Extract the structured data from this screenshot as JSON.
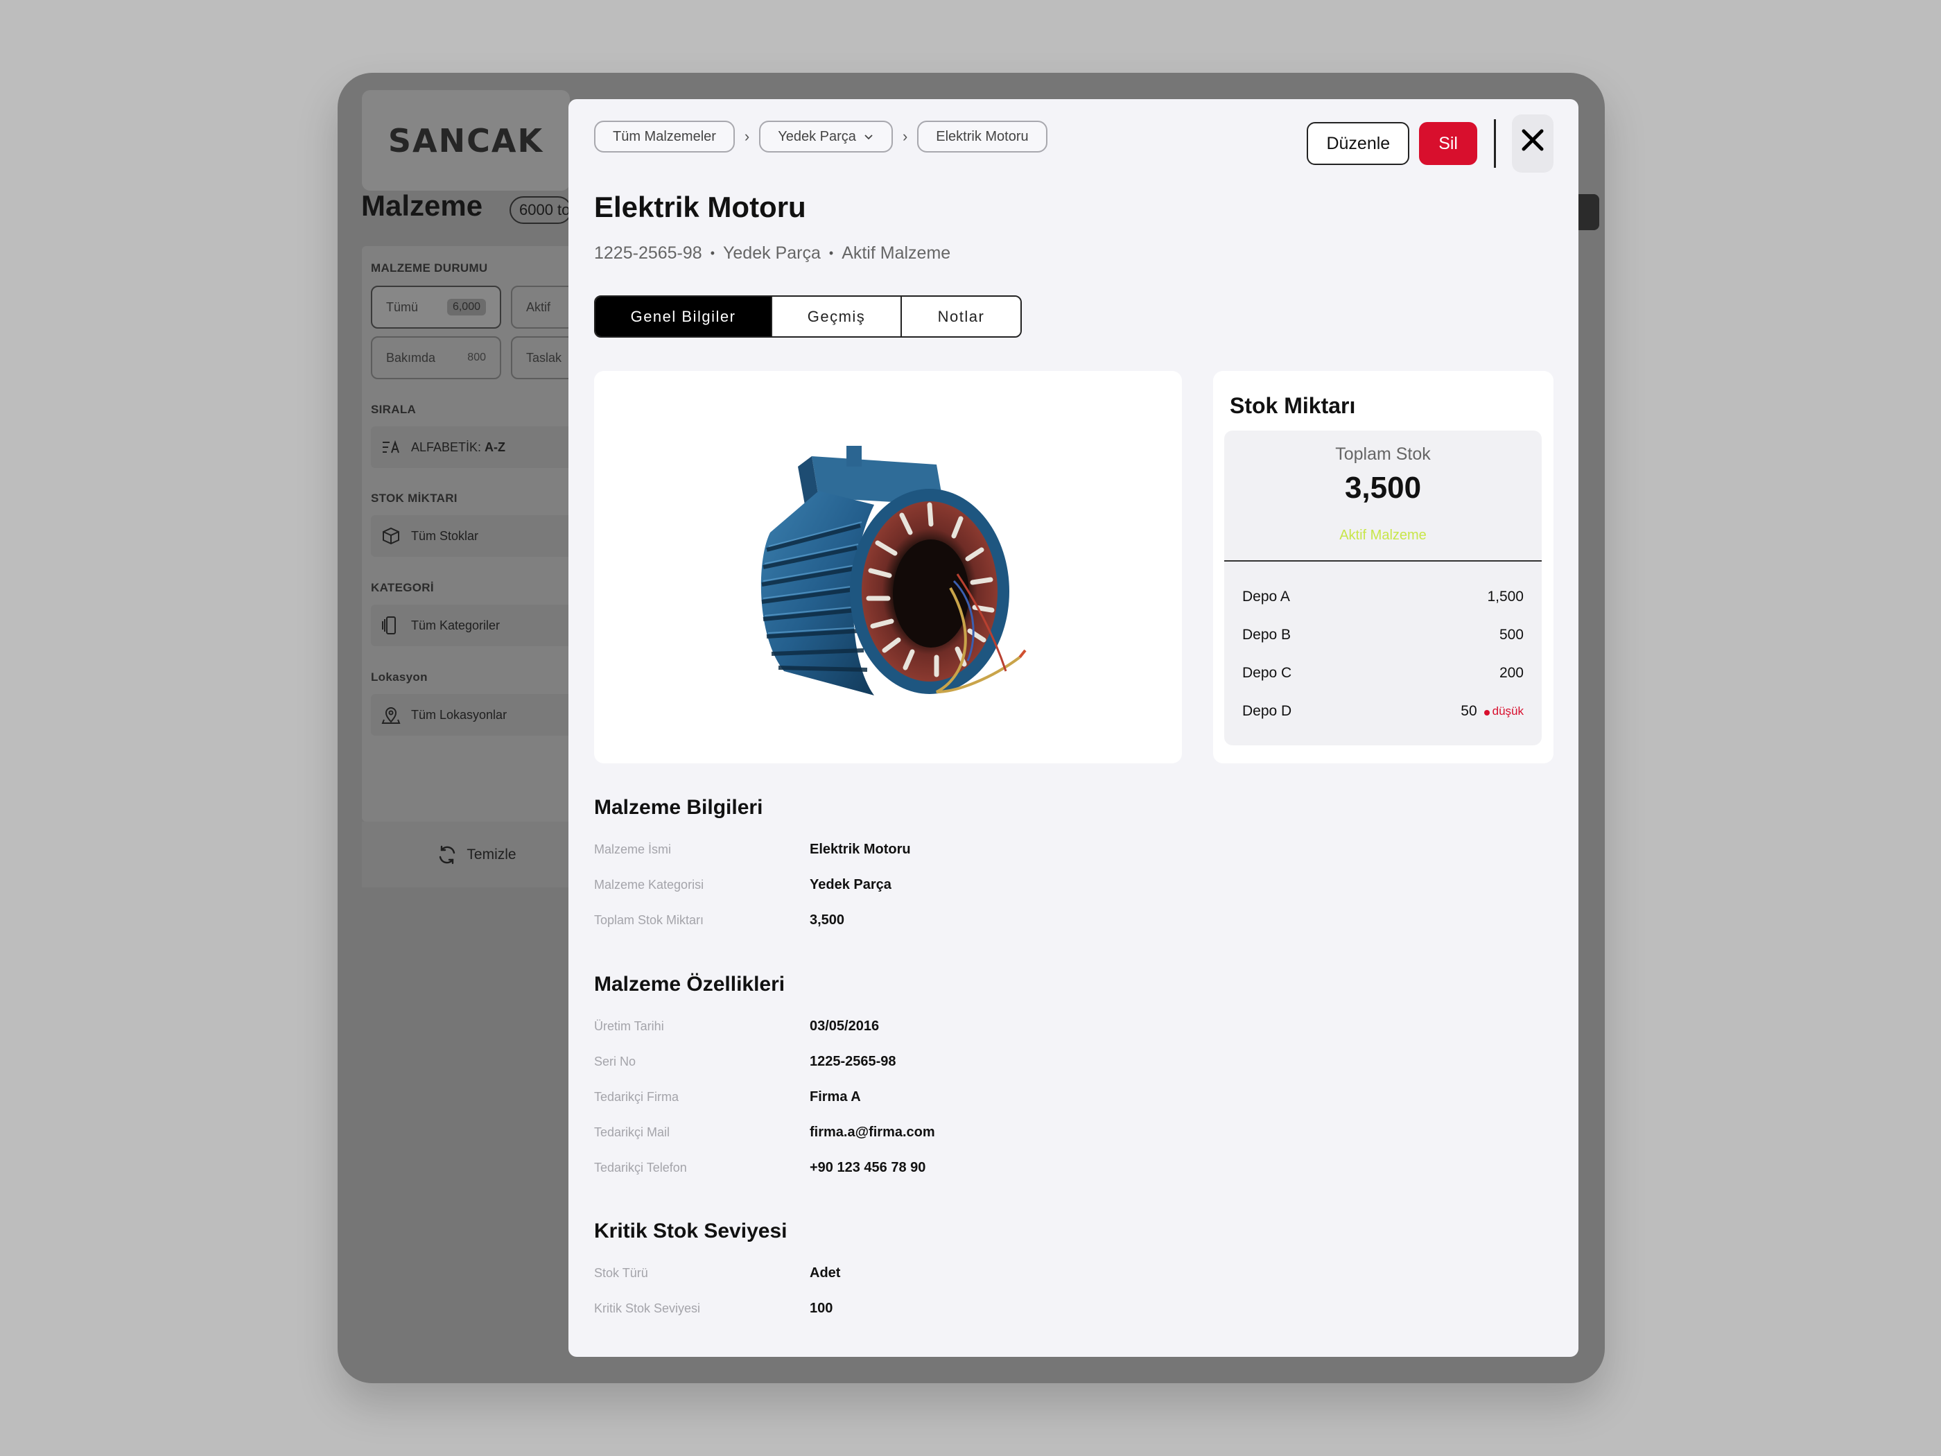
{
  "background": {
    "logo": "SANCAK",
    "title": "Malzeme",
    "count": "6000 to",
    "sections": {
      "status": "MALZEME DURUMU",
      "sort": "SIRALA",
      "stock": "STOK MİKTARI",
      "category": "KATEGORİ",
      "location": "Lokasyon"
    },
    "chips": [
      {
        "label": "Tümü",
        "count": "6,000"
      },
      {
        "label": "Aktif",
        "count": ""
      },
      {
        "label": "Bakımda",
        "count": "800"
      },
      {
        "label": "Taslak",
        "count": ""
      }
    ],
    "sort_label": "ALFABETİK: ",
    "sort_value": "A-Z",
    "stock_filter": "Tüm Stoklar",
    "category_filter": "Tüm Kategoriler",
    "location_filter": "Tüm Lokasyonlar",
    "clear_label": "Temizle"
  },
  "modal": {
    "breadcrumb": [
      "Tüm Malzemeler",
      "Yedek Parça",
      "Elektrik Motoru"
    ],
    "edit_label": "Düzenle",
    "delete_label": "Sil",
    "title": "Elektrik Motoru",
    "subline": [
      "1225-2565-98",
      "Yedek Parça",
      "Aktif Malzeme"
    ],
    "tabs": [
      "Genel Bilgiler",
      "Geçmiş",
      "Notlar"
    ],
    "active_tab": "Genel Bilgiler",
    "image_alt": "electric-motor-stator",
    "stock": {
      "title": "Stok Miktarı",
      "total_label": "Toplam Stok",
      "total_value": "3,500",
      "status": "Aktif Malzeme",
      "depots": [
        {
          "name": "Depo A",
          "value": "1,500",
          "tag": ""
        },
        {
          "name": "Depo B",
          "value": "500",
          "tag": ""
        },
        {
          "name": "Depo C",
          "value": "200",
          "tag": ""
        },
        {
          "name": "Depo D",
          "value": "50",
          "tag": "düşük"
        }
      ]
    },
    "sections": [
      {
        "title": "Malzeme Bilgileri",
        "rows": [
          {
            "label": "Malzeme İsmi",
            "value": "Elektrik Motoru"
          },
          {
            "label": "Malzeme Kategorisi",
            "value": "Yedek Parça"
          },
          {
            "label": "Toplam Stok Miktarı",
            "value": "3,500"
          }
        ]
      },
      {
        "title": "Malzeme Özellikleri",
        "rows": [
          {
            "label": "Üretim Tarihi",
            "value": "03/05/2016"
          },
          {
            "label": "Seri No",
            "value": "1225-2565-98"
          },
          {
            "label": "Tedarikçi Firma",
            "value": "Firma A"
          },
          {
            "label": "Tedarikçi Mail",
            "value": "firma.a@firma.com"
          },
          {
            "label": "Tedarikçi Telefon",
            "value": "+90 123 456 78 90"
          }
        ]
      },
      {
        "title": "Kritik Stok Seviyesi",
        "rows": [
          {
            "label": "Stok Türü",
            "value": "Adet"
          },
          {
            "label": "Kritik Stok Seviyesi",
            "value": "100"
          }
        ]
      }
    ]
  },
  "colors": {
    "accent_red": "#d80f2d",
    "status_green": "#c8e64a",
    "tab_active": "#000000"
  }
}
